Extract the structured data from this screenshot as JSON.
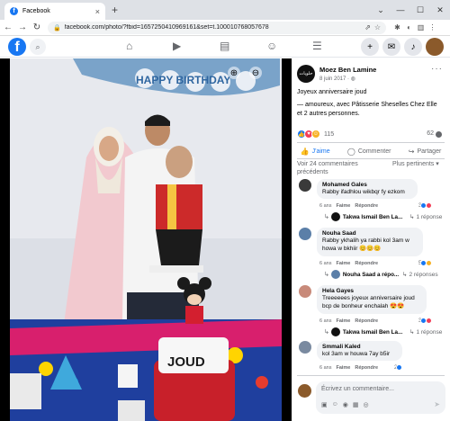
{
  "browser": {
    "tab_title": "Facebook",
    "tab_close": "×",
    "new_tab": "+",
    "url": "facebook.com/photo/?fbid=1657250410969161&set=t.100010768057678"
  },
  "post": {
    "avatar_text": "حلويات",
    "author": "Moez Ben Lamine",
    "date": "8 juin 2017 · ",
    "text": "Joyeux anniversaire joud",
    "with_text": "— amoureux, avec Pâtisserie Sheselles Chez Elle et 2 autres personnes.",
    "reaction_count": "115",
    "comment_count": "62",
    "actions": {
      "like": "J'aime",
      "comment": "Commenter",
      "share": "Partager"
    },
    "previous_comments": "Voir 24 commentaires précédents",
    "sort": "Plus pertinents ▾",
    "cake_text": "JOUD",
    "banner_text": "HAPPY BIRTHDAY"
  },
  "comments": [
    {
      "author": "Mohamed Gales",
      "text": "Rabby ifadhlou wikbqr fy ezkom",
      "time": "6 ans",
      "like": "Faime",
      "reply": "Répondre",
      "reacts": "3",
      "reply_author": "Takwa Ismail Ben La...",
      "reply_count": "1 réponse"
    },
    {
      "author": "Nouha Saad",
      "text": "Rabby ykhalih ya rabbi kol 3am w howa w bkhiir 😊😊😊",
      "time": "6 ans",
      "like": "Faime",
      "reply": "Répondre",
      "reacts": "5",
      "reply_author": "Nouha Saad a répo...",
      "reply_count": "2 réponses"
    },
    {
      "author": "Hela Gayes",
      "text": "Treeeeees joyeux anniversaire joud bcp de bonheur enchalah 😍😍",
      "time": "6 ans",
      "like": "Faime",
      "reply": "Répondre",
      "reacts": "3",
      "reply_author": "Takwa Ismail Ben La...",
      "reply_count": "1 réponse"
    },
    {
      "author": "Smmali Kaled",
      "text": "kol 3am w houwa 7ay b5ir",
      "time": "6 ans",
      "like": "Faime",
      "reply": "Répondre",
      "reacts": "2"
    }
  ],
  "composer": {
    "placeholder": "Écrivez un commentaire..."
  },
  "colors": {
    "accent": "#1877f2",
    "love": "#f33e58",
    "care": "#f7b125"
  }
}
